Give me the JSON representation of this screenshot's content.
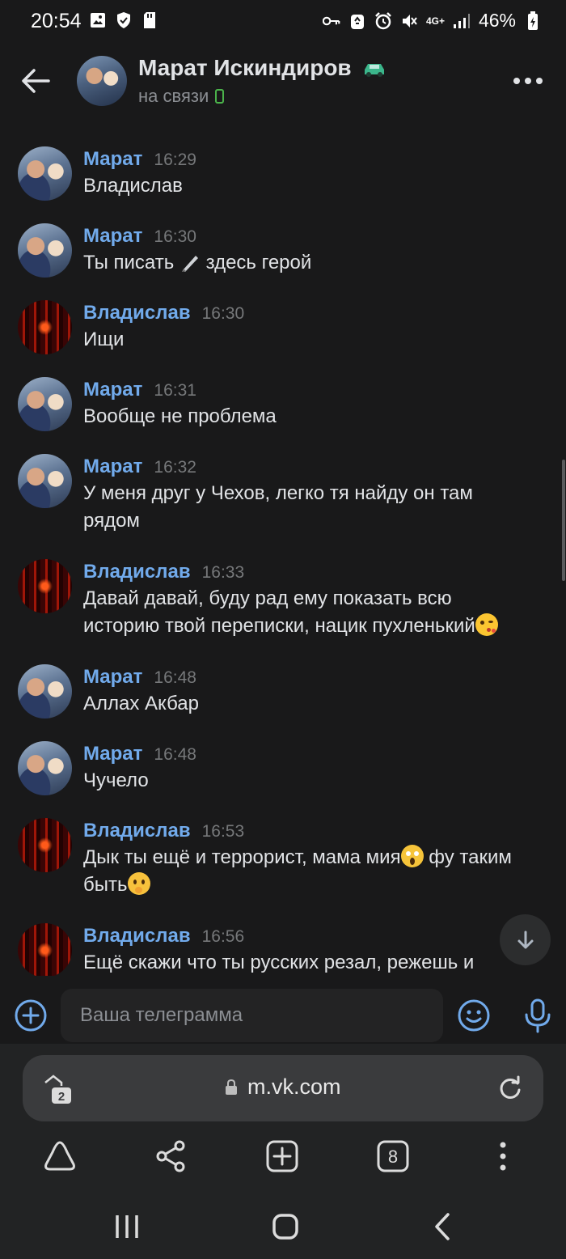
{
  "status_bar": {
    "time": "20:54",
    "network": "4G+",
    "battery": "46%"
  },
  "header": {
    "name": "Марат Искиндиров",
    "status": "на связи"
  },
  "composer": {
    "placeholder": "Ваша телеграмма"
  },
  "browser": {
    "url": "m.vk.com",
    "tabs_count": "2",
    "open_tabs": "8"
  },
  "messages": [
    {
      "sender": "Марат",
      "time": "16:29",
      "text": "Владислав"
    },
    {
      "sender": "Марат",
      "time": "16:30",
      "text_before": "Ты писать ",
      "text_after": " здесь герой"
    },
    {
      "sender": "Владислав",
      "time": "16:30",
      "text": "Ищи"
    },
    {
      "sender": "Марат",
      "time": "16:31",
      "text": "Вообще не проблема"
    },
    {
      "sender": "Марат",
      "time": "16:32",
      "line1": "У меня друг у Чехов, легко тя найду он там",
      "line2": "рядом"
    },
    {
      "sender": "Владислав",
      "time": "16:33",
      "line1": "Давай давай, буду рад ему показать всю",
      "line2": "историю твой переписки, нацик пухленький"
    },
    {
      "sender": "Марат",
      "time": "16:48",
      "text": "Аллах Акбар"
    },
    {
      "sender": "Марат",
      "time": "16:48",
      "text": "Чучело"
    },
    {
      "sender": "Владислав",
      "time": "16:53",
      "line1a": "Дык ты ещё и террорист, мама мия",
      "line1b": " фу таким",
      "line2": "быть"
    },
    {
      "sender": "Владислав",
      "time": "16:56",
      "line1": "Ещё скажи что ты русских резал, режешь и"
    }
  ]
}
